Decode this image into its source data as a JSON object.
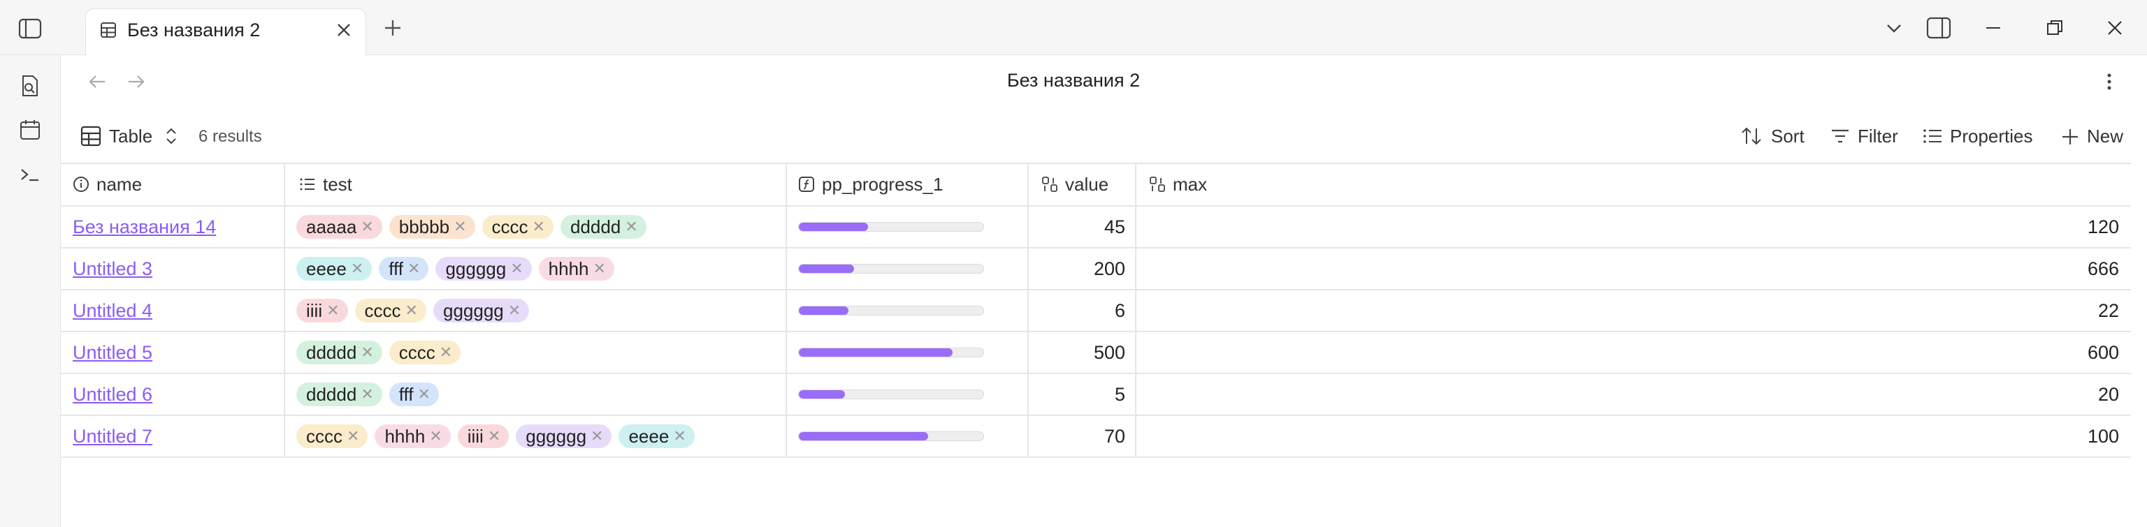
{
  "tab": {
    "title": "Без названия 2"
  },
  "header": {
    "title": "Без названия 2"
  },
  "toolbar": {
    "view_label": "Table",
    "results": "6 results",
    "sort": "Sort",
    "filter": "Filter",
    "properties": "Properties",
    "new": "New"
  },
  "columns": [
    "name",
    "test",
    "pp_progress_1",
    "value",
    "max"
  ],
  "tag_colors": {
    "aaaaa": "#f9d9dc",
    "bbbbb": "#fbe3cf",
    "cccc": "#fbeccb",
    "ddddd": "#d4f1df",
    "eeee": "#cdf0f0",
    "fff": "#d4e4fb",
    "gggggg": "#e6dcfa",
    "hhhh": "#f9dbe6",
    "iiii": "#f9d9dc"
  },
  "accent": "#9b6cf7",
  "rows": [
    {
      "name": "Без названия 14",
      "tags": [
        "aaaaa",
        "bbbbb",
        "cccc",
        "ddddd"
      ],
      "progress": 0.375,
      "value": "45",
      "max": "120"
    },
    {
      "name": "Untitled 3",
      "tags": [
        "eeee",
        "fff",
        "gggggg",
        "hhhh"
      ],
      "progress": 0.3,
      "value": "200",
      "max": "666"
    },
    {
      "name": "Untitled 4",
      "tags": [
        "iiii",
        "cccc",
        "gggggg"
      ],
      "progress": 0.27,
      "value": "6",
      "max": "22"
    },
    {
      "name": "Untitled 5",
      "tags": [
        "ddddd",
        "cccc"
      ],
      "progress": 0.833,
      "value": "500",
      "max": "600"
    },
    {
      "name": "Untitled 6",
      "tags": [
        "ddddd",
        "fff"
      ],
      "progress": 0.25,
      "value": "5",
      "max": "20"
    },
    {
      "name": "Untitled 7",
      "tags": [
        "cccc",
        "hhhh",
        "iiii",
        "gggggg",
        "eeee"
      ],
      "progress": 0.7,
      "value": "70",
      "max": "100"
    }
  ]
}
